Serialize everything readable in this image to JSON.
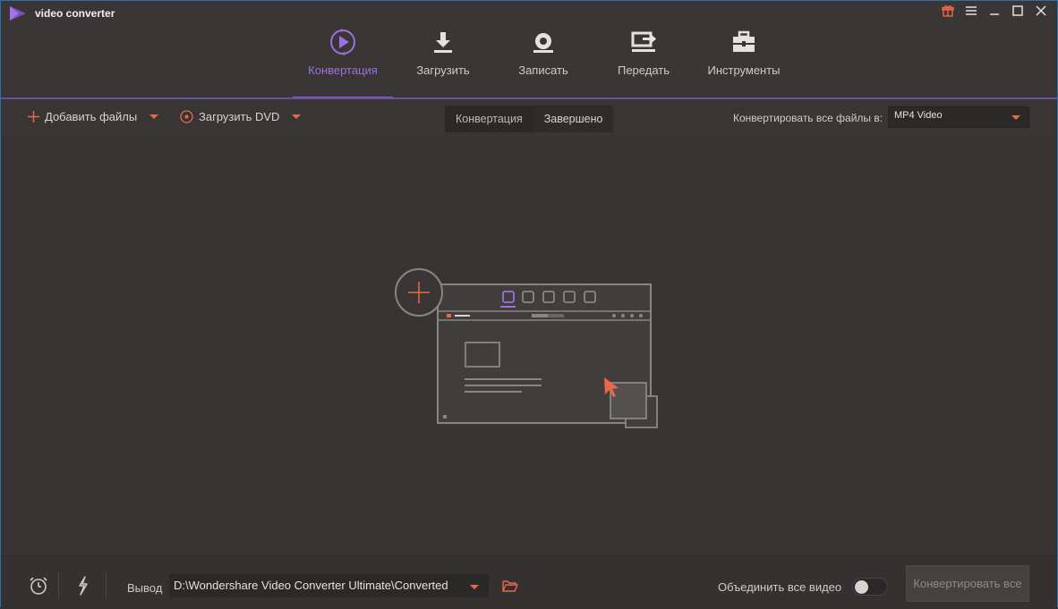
{
  "app": {
    "title": "video converter",
    "accent": "#8a60d0",
    "orange": "#e8684a"
  },
  "window_controls": [
    {
      "name": "gift-icon"
    },
    {
      "name": "menu-icon"
    },
    {
      "name": "minimize-icon"
    },
    {
      "name": "maximize-icon"
    },
    {
      "name": "close-icon"
    }
  ],
  "nav": {
    "items": [
      {
        "label": "Конвертация",
        "icon": "convert-play-icon",
        "active": true
      },
      {
        "label": "Загрузить",
        "icon": "download-icon",
        "active": false
      },
      {
        "label": "Записать",
        "icon": "record-icon",
        "active": false
      },
      {
        "label": "Передать",
        "icon": "transfer-icon",
        "active": false
      },
      {
        "label": "Инструменты",
        "icon": "toolbox-icon",
        "active": false
      }
    ]
  },
  "toolbar": {
    "add_files": "Добавить файлы",
    "load_dvd": "Загрузить DVD",
    "tab_converting": "Конвертация",
    "tab_finished": "Завершено",
    "convert_all_to_label": "Конвертировать все файлы в:",
    "format_value": "MP4 Video"
  },
  "footer": {
    "output_label": "Вывод",
    "output_path": "D:\\Wondershare Video Converter Ultimate\\Converted",
    "merge_label": "Объединить все видео",
    "merge_enabled": false,
    "convert_all_button": "Конвертировать все"
  }
}
